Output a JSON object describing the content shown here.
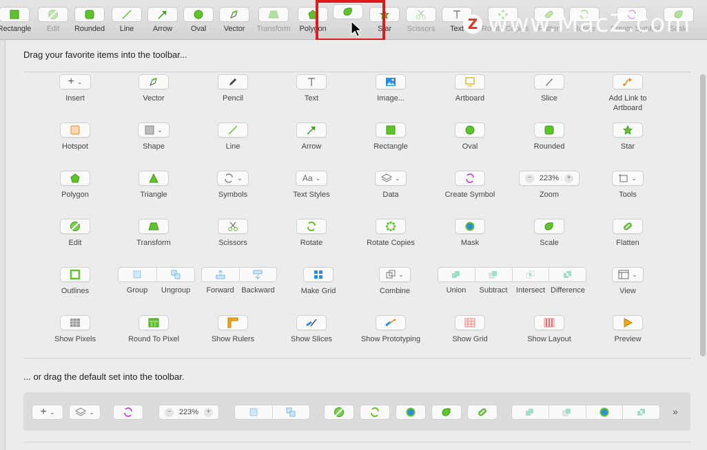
{
  "toolbar": {
    "items": [
      {
        "label": "Rectangle",
        "icon": "rectangle-icon"
      },
      {
        "label": "Edit",
        "icon": "edit-icon"
      },
      {
        "label": "Rounded",
        "icon": "rounded-icon"
      },
      {
        "label": "Line",
        "icon": "line-icon"
      },
      {
        "label": "Arrow",
        "icon": "arrow-icon"
      },
      {
        "label": "Oval",
        "icon": "oval-icon"
      },
      {
        "label": "Vector",
        "icon": "vector-icon"
      },
      {
        "label": "Transform",
        "icon": "transform-icon"
      },
      {
        "label": "Polygon",
        "icon": "polygon-icon"
      },
      {
        "label": "",
        "icon": "scale-icon"
      },
      {
        "label": "Star",
        "icon": "star-icon"
      },
      {
        "label": "Scissors",
        "icon": "scissors-icon"
      },
      {
        "label": "Text",
        "icon": "text-icon"
      },
      {
        "label": "Rotate Copies",
        "icon": "rotate-copies-icon"
      },
      {
        "label": "Flatten",
        "icon": "flatten-icon"
      },
      {
        "label": "Rotate",
        "icon": "rotate-icon"
      },
      {
        "label": "Create Symbol",
        "icon": "create-symbol-icon"
      },
      {
        "label": "Scale",
        "icon": "scale-icon"
      }
    ]
  },
  "watermark": {
    "logo": "Z",
    "text": "www.MacZ.com"
  },
  "sheet": {
    "heading": "Drag your favorite items into the toolbar...",
    "default_heading": "... or drag the default set into the toolbar."
  },
  "items": {
    "insert": "Insert",
    "vector": "Vector",
    "pencil": "Pencil",
    "text": "Text",
    "image": "Image...",
    "artboard": "Artboard",
    "slice": "Slice",
    "add_link": "Add Link to Artboard",
    "hotspot": "Hotspot",
    "shape": "Shape",
    "line": "Line",
    "arrow": "Arrow",
    "rectangle": "Rectangle",
    "oval": "Oval",
    "rounded": "Rounded",
    "star": "Star",
    "polygon": "Polygon",
    "triangle": "Triangle",
    "symbols": "Symbols",
    "text_styles": "Text Styles",
    "data": "Data",
    "create_symbol": "Create Symbol",
    "zoom": "Zoom",
    "tools": "Tools",
    "edit": "Edit",
    "transform": "Transform",
    "scissors": "Scissors",
    "rotate": "Rotate",
    "rotate_copies": "Rotate Copies",
    "mask": "Mask",
    "scale": "Scale",
    "flatten": "Flatten",
    "outlines": "Outlines",
    "group": "Group",
    "ungroup": "Ungroup",
    "forward": "Forward",
    "backward": "Backward",
    "make_grid": "Make Grid",
    "combine": "Combine",
    "union": "Union",
    "subtract": "Subtract",
    "intersect": "Intersect",
    "difference": "Difference",
    "view": "View",
    "show_pixels": "Show Pixels",
    "round_to_pixel": "Round To Pixel",
    "show_rulers": "Show Rulers",
    "show_slices": "Show Slices",
    "show_prototyping": "Show Prototyping",
    "show_grid": "Show Grid",
    "show_layout": "Show Layout",
    "preview": "Preview",
    "zoom_value": "223%",
    "text_styles_glyph": "Aa"
  },
  "default_set": {
    "zoom_value": "223%",
    "more": "»"
  },
  "colors": {
    "accent_green": "#5ec42a",
    "highlight_red": "#e01a1a",
    "purple": "#b22fd6",
    "orange": "#f08a1a"
  }
}
